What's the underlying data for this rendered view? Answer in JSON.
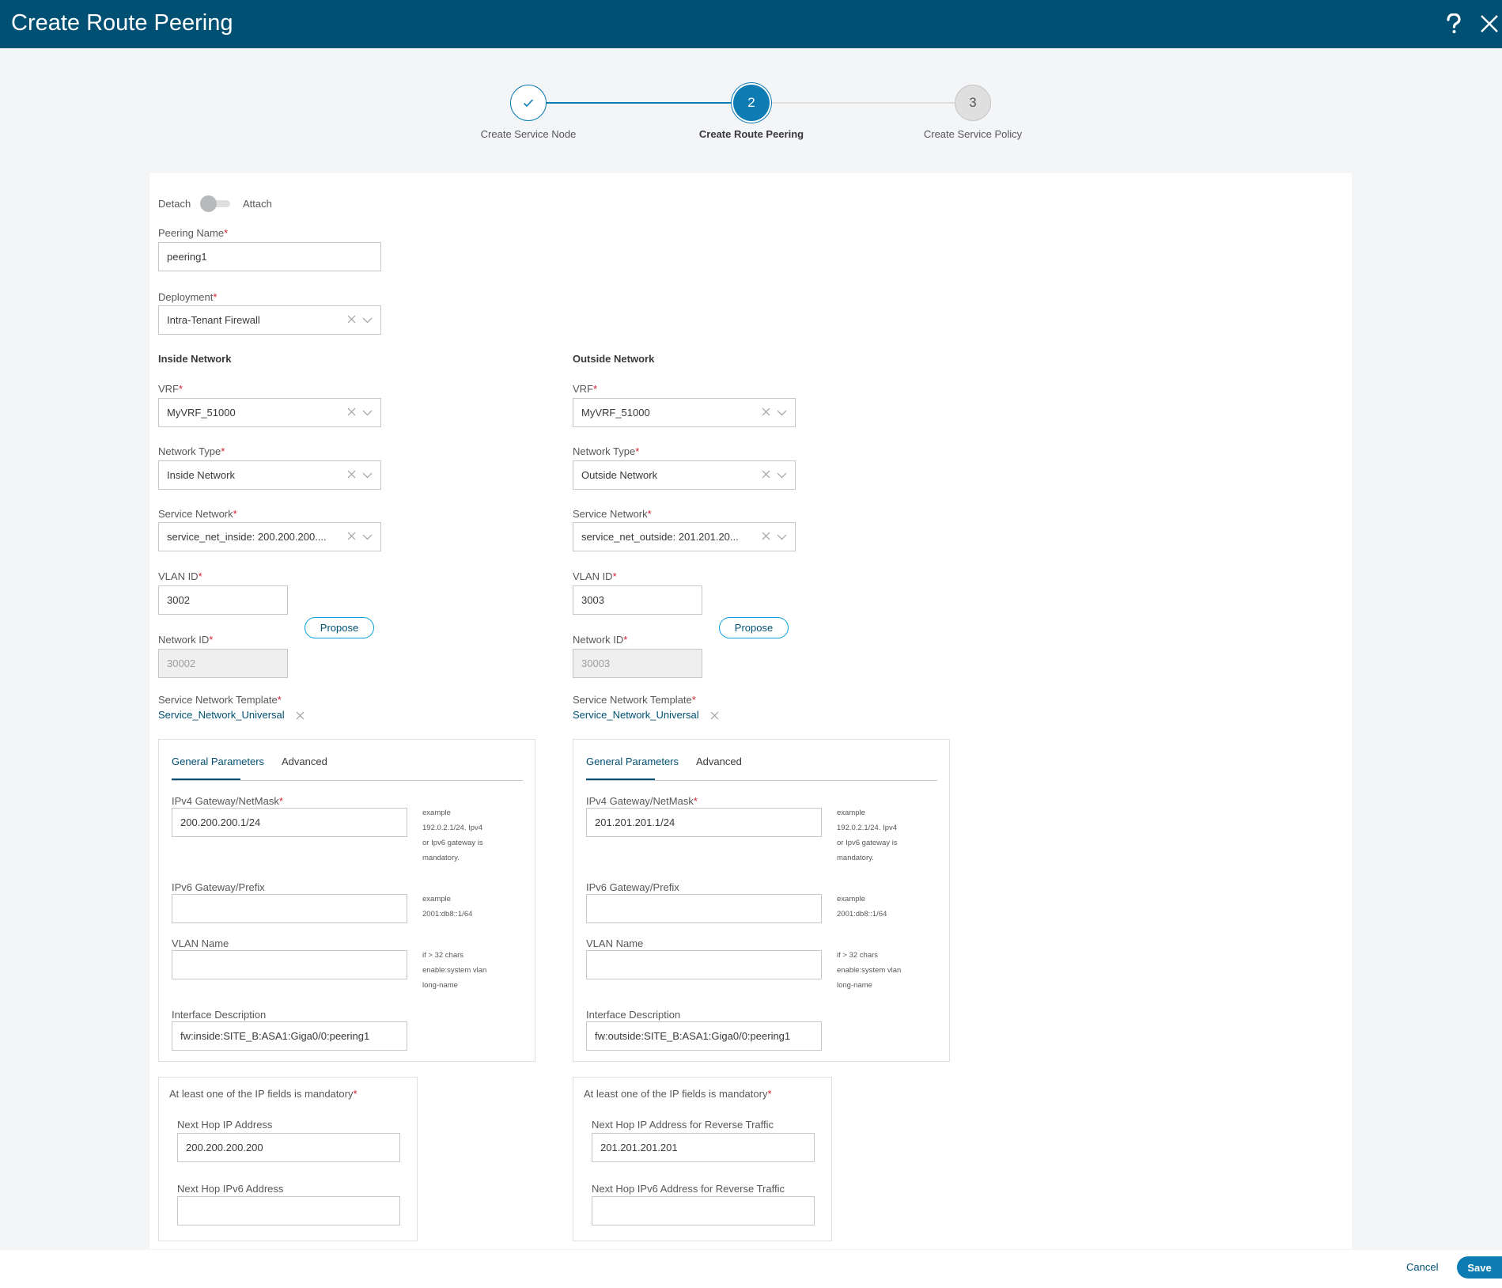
{
  "header": {
    "title": "Create Route Peering"
  },
  "steps": [
    {
      "label": "Create Service Node",
      "num": ""
    },
    {
      "label": "Create Route Peering",
      "num": "2"
    },
    {
      "label": "Create Service Policy",
      "num": "3"
    }
  ],
  "toggle": {
    "left": "Detach",
    "right": "Attach"
  },
  "peering": {
    "label": "Peering Name",
    "value": "peering1"
  },
  "deployment": {
    "label": "Deployment",
    "value": "Intra-Tenant Firewall"
  },
  "inside": {
    "heading": "Inside Network",
    "vrf_label": "VRF",
    "vrf": "MyVRF_51000",
    "nt_label": "Network Type",
    "nt": "Inside Network",
    "sn_label": "Service Network",
    "sn": "service_net_inside: 200.200.200....",
    "vlan_label": "VLAN ID",
    "vlan": "3002",
    "propose": "Propose",
    "netid_label": "Network ID",
    "netid": "30002",
    "tpl_label": "Service Network Template",
    "tpl": "Service_Network_Universal",
    "tab_general": "General Parameters",
    "tab_adv": "Advanced",
    "ipv4_label": "IPv4 Gateway/NetMask",
    "ipv4": "200.200.200.1/24",
    "ipv4_hint": [
      "example",
      "192.0.2.1/24. Ipv4",
      "or Ipv6 gateway is",
      "mandatory."
    ],
    "ipv6_label": "IPv6 Gateway/Prefix",
    "ipv6": "",
    "ipv6_hint": [
      "example",
      "2001:db8::1/64"
    ],
    "vname_label": "VLAN Name",
    "vname": "",
    "vname_hint": [
      "if > 32 chars",
      "enable:system vlan",
      "long-name"
    ],
    "idesc_label": "Interface Description",
    "idesc": "fw:inside:SITE_B:ASA1:Giga0/0:peering1",
    "mand": "At least one of the IP fields is mandatory",
    "nh4_label": "Next Hop IP Address",
    "nh4": "200.200.200.200",
    "nh6_label": "Next Hop IPv6 Address",
    "nh6": ""
  },
  "outside": {
    "heading": "Outside Network",
    "vrf_label": "VRF",
    "vrf": "MyVRF_51000",
    "nt_label": "Network Type",
    "nt": "Outside Network",
    "sn_label": "Service Network",
    "sn": "service_net_outside: 201.201.20...",
    "vlan_label": "VLAN ID",
    "vlan": "3003",
    "propose": "Propose",
    "netid_label": "Network ID",
    "netid": "30003",
    "tpl_label": "Service Network Template",
    "tpl": "Service_Network_Universal",
    "tab_general": "General Parameters",
    "tab_adv": "Advanced",
    "ipv4_label": "IPv4 Gateway/NetMask",
    "ipv4": "201.201.201.1/24",
    "ipv4_hint": [
      "example",
      "192.0.2.1/24. Ipv4",
      "or Ipv6 gateway is",
      "mandatory."
    ],
    "ipv6_label": "IPv6 Gateway/Prefix",
    "ipv6": "",
    "ipv6_hint": [
      "example",
      "2001:db8::1/64"
    ],
    "vname_label": "VLAN Name",
    "vname": "",
    "vname_hint": [
      "if > 32 chars",
      "enable:system vlan",
      "long-name"
    ],
    "idesc_label": "Interface Description",
    "idesc": "fw:outside:SITE_B:ASA1:Giga0/0:peering1",
    "mand": "At least one of the IP fields is mandatory",
    "nh4_label": "Next Hop IP Address for Reverse Traffic",
    "nh4": "201.201.201.201",
    "nh6_label": "Next Hop IPv6 Address for Reverse Traffic",
    "nh6": ""
  },
  "footer": {
    "cancel": "Cancel",
    "save": "Save"
  },
  "colors": {
    "header": "#005073",
    "accent": "#049fd9",
    "link": "#005073",
    "required": "#cf2030"
  }
}
